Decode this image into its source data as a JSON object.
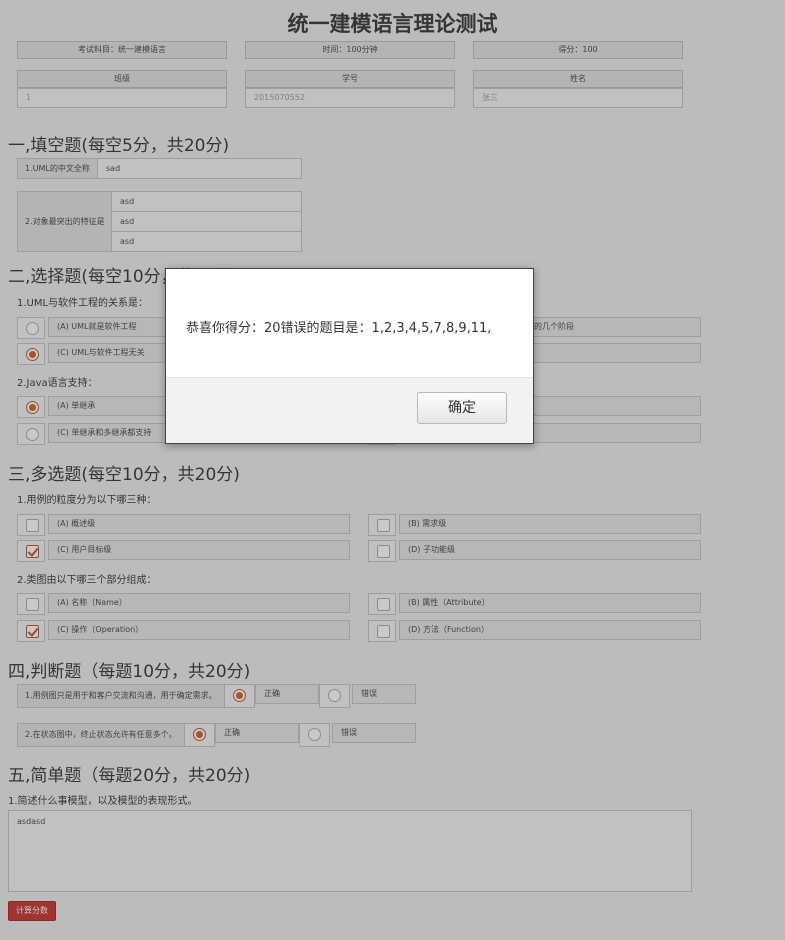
{
  "header": {
    "title": "统一建模语言理论测试",
    "subject": "考试科目：统一建模语言",
    "time": "时间：100分钟",
    "score": "得分：100",
    "class_label": "班级",
    "id_label": "学号",
    "name_label": "姓名",
    "class_value": "1",
    "id_value": "2015070552",
    "name_value": "张三"
  },
  "section1": {
    "title": "一,填空题(每空5分，共20分)",
    "q1_label": "1.UML的中文全称",
    "q1_value": "sad",
    "q2_label": "2.对象最突出的特征是",
    "q2_values": [
      "asd",
      "asd",
      "asd"
    ]
  },
  "section2": {
    "title": "二,选择题(每空10分，共20分)",
    "q1": "1.UML与软件工程的关系是：",
    "q1_opts": [
      "(A) UML就是软件工程",
      "",
      "(C) UML与软件工程无关",
      ""
    ],
    "q1_right_top": "的几个阶段",
    "q2": "2.Java语言支持：",
    "q2_opts": [
      "(A) 单继承",
      "",
      "(C) 单继承和多继承都支持",
      ""
    ]
  },
  "section3": {
    "title": "三,多选题(每空10分，共20分)",
    "q1": "1.用例的粒度分为以下哪三种：",
    "q1_opts": [
      "(A) 概述级",
      "(B) 需求级",
      "(C) 用户目标级",
      "(D) 子功能级"
    ],
    "q2": "2.类图由以下哪三个部分组成：",
    "q2_opts": [
      "(A) 名称（Name）",
      "(B) 属性（Attribute）",
      "(C) 操作（Operation）",
      "(D) 方法（Function）"
    ]
  },
  "section4": {
    "title": "四,判断题（每题10分，共20分)",
    "q1": "1.用例图只是用于和客户交流和沟通，用于确定需求。",
    "q2": "2.在状态图中，终止状态允许有任意多个。",
    "true_label": "正确",
    "false_label": "错误"
  },
  "section5": {
    "title": "五,简单题（每题20分，共20分)",
    "q1": "1.简述什么事模型，以及模型的表现形式。",
    "answer": "asdasd"
  },
  "calc_button": "计算分数",
  "dialog": {
    "message": "恭喜你得分：20错误的题目是：1,2,3,4,5,7,8,9,11,",
    "ok": "确定"
  },
  "colors": {
    "accent": "#d25a2e",
    "button": "#c9302c"
  }
}
